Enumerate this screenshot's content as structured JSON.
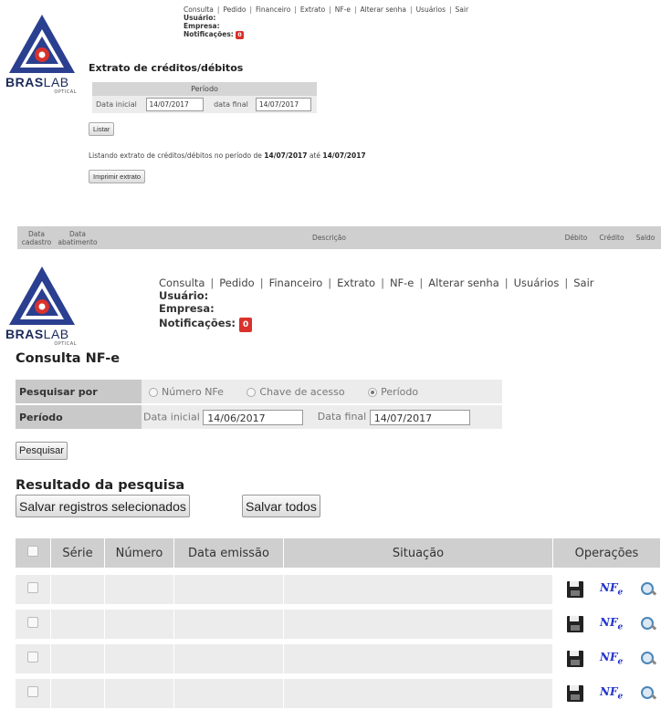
{
  "logo": {
    "brand_bold": "BRAS",
    "brand_light": "LAB",
    "sub": "OPTICAL",
    "colors": {
      "red": "#d9312b",
      "blue": "#2a3f8f"
    }
  },
  "nav": {
    "links": [
      "Consulta",
      "Pedido",
      "Financeiro",
      "Extrato",
      "NF-e",
      "Alterar senha",
      "Usuários",
      "Sair"
    ],
    "separator": "|",
    "usuario_label": "Usuário:",
    "empresa_label": "Empresa:",
    "notificacoes_label": "Notificações:",
    "notificacoes_count": "0"
  },
  "extrato": {
    "title": "Extrato de créditos/débitos",
    "period_header": "Período",
    "data_inicial_label": "Data inicial",
    "data_inicial_value": "14/07/2017",
    "data_final_label": "data final",
    "data_final_value": "14/07/2017",
    "listar_button": "Listar",
    "msg_prefix": "Listando extrato de créditos/débitos no período de ",
    "msg_from": "14/07/2017",
    "msg_mid": " até ",
    "msg_to": "14/07/2017",
    "imprimir_button": "Imprimir extrato",
    "columns": [
      "Data cadastro",
      "Data abatimento",
      "Descrição",
      "Débito",
      "Crédito",
      "Saldo"
    ]
  },
  "nfe": {
    "title": "Consulta NF-e",
    "pesquisar_por_label": "Pesquisar por",
    "radio_options": [
      "Número NFe",
      "Chave de acesso",
      "Período"
    ],
    "radio_selected": "Período",
    "periodo_label": "Período",
    "data_inicial_label": "Data inicial",
    "data_inicial_value": "14/06/2017",
    "data_final_label": "Data final",
    "data_final_value": "14/07/2017",
    "pesquisar_button": "Pesquisar",
    "resultado_title": "Resultado da pesquisa",
    "salvar_selecionados_button": "Salvar registros selecionados",
    "salvar_todos_button": "Salvar todos",
    "columns": [
      "Série",
      "Número",
      "Data emissão",
      "Situação",
      "Operações"
    ],
    "rows": [
      {
        "serie": "",
        "numero": "",
        "data": "",
        "situacao": ""
      },
      {
        "serie": "",
        "numero": "",
        "data": "",
        "situacao": ""
      },
      {
        "serie": "",
        "numero": "",
        "data": "",
        "situacao": ""
      },
      {
        "serie": "",
        "numero": "",
        "data": "",
        "situacao": ""
      }
    ],
    "op_icons": [
      "save-icon",
      "nfe-icon",
      "magnifier-icon"
    ],
    "nfe_icon_text": "NF",
    "nfe_icon_sub": "e"
  }
}
